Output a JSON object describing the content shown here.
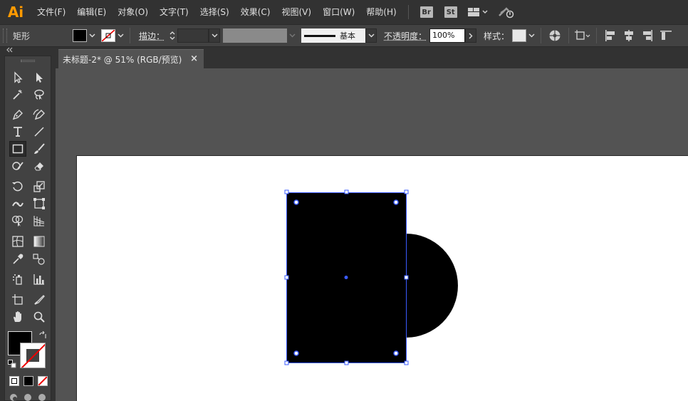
{
  "app": {
    "logo": "Ai"
  },
  "menu": {
    "items": [
      "文件(F)",
      "编辑(E)",
      "对象(O)",
      "文字(T)",
      "选择(S)",
      "效果(C)",
      "视图(V)",
      "窗口(W)",
      "帮助(H)"
    ],
    "bridge_badge": "Br",
    "stock_badge": "St"
  },
  "control_bar": {
    "object_type": "矩形",
    "stroke_label": "描边：",
    "stroke_style_label": "基本",
    "opacity_label": "不透明度：",
    "opacity_value": "100%",
    "style_label": "样式："
  },
  "document_tab": {
    "title": "未标题-2* @ 51% (RGB/预览)",
    "close_glyph": "×"
  },
  "colors": {
    "fill": "#000000",
    "stroke": "none",
    "selection": "#3a5bff"
  }
}
